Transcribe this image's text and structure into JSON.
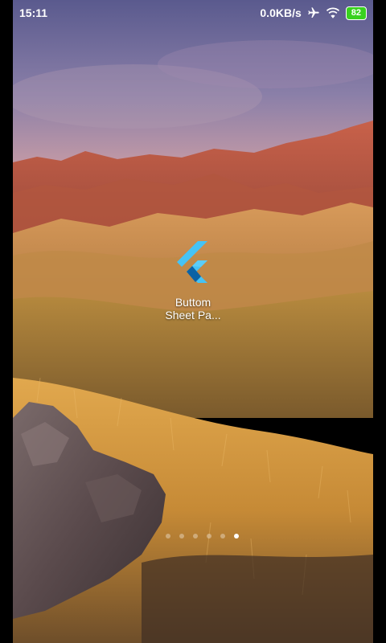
{
  "status_bar": {
    "time": "15:11",
    "network_speed": "0.0KB/s",
    "airplane_icon": "airplane-icon",
    "wifi_icon": "wifi-icon",
    "battery_level": "82",
    "battery_color": "#39d21f"
  },
  "home_screen": {
    "app": {
      "label_line1": "Buttom",
      "label_line2": "Sheet Pa...",
      "icon": "flutter-logo-icon"
    },
    "page_indicator": {
      "pages": 6,
      "active_index": 5
    }
  }
}
